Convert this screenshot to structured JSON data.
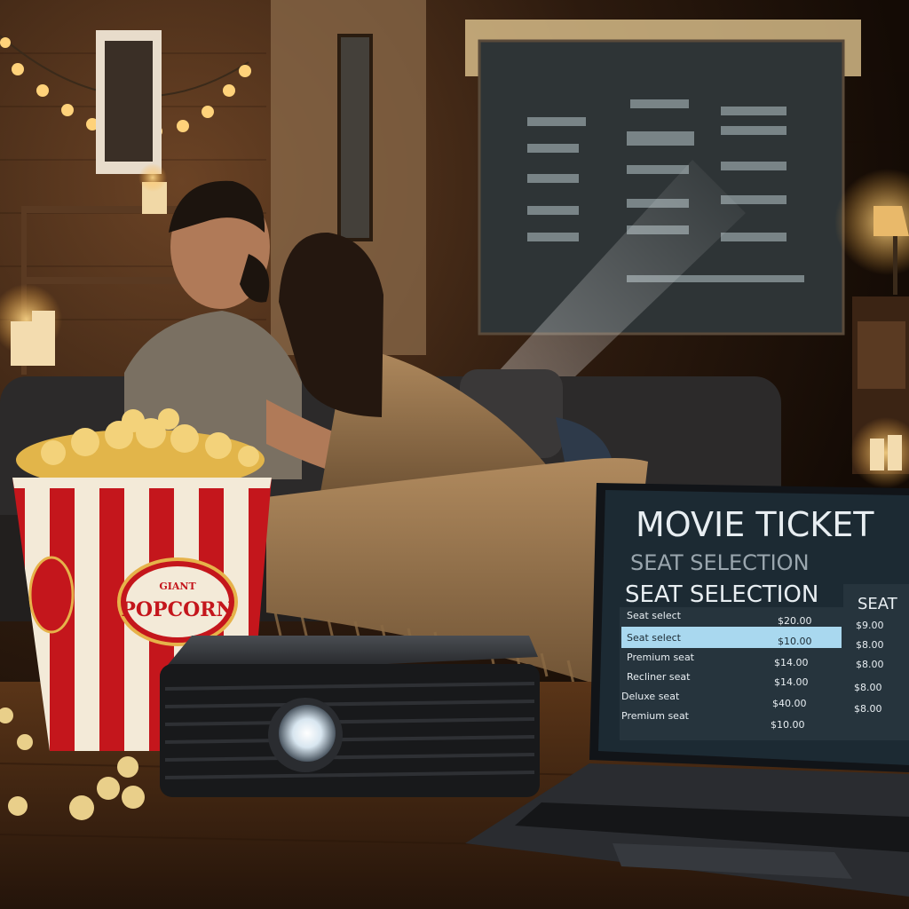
{
  "scene": {
    "description_free": true,
    "colors": {
      "wall": "#3a2516",
      "warm_light": "#f6c56a",
      "screen": "#2e3436",
      "popcorn_red": "#c4161c",
      "laptop_screen": "#1c2a33",
      "highlight_row": "#a9d8ef"
    }
  },
  "popcorn": {
    "brand_top": "GIANT",
    "brand_main": "POPCORN"
  },
  "laptop": {
    "title": "MOVIE TICKET",
    "subtitle_dim": "SEAT SELECTION",
    "subtitle": "SEAT SELECTION",
    "side_header": "SEAT",
    "rows": [
      {
        "label": "Seat select",
        "price": "$20.00"
      },
      {
        "label": "Seat select",
        "price": "$10.00"
      },
      {
        "label": "Premium seat",
        "price": "$14.00"
      },
      {
        "label": "Recliner seat",
        "price": "$14.00"
      },
      {
        "label": "Deluxe seat",
        "price": "$40.00"
      },
      {
        "label": "Premium seat",
        "price": "$10.00"
      }
    ],
    "side_values": [
      "$9.00",
      "$8.00",
      "$8.00",
      "$8.00",
      "$8.00"
    ]
  }
}
